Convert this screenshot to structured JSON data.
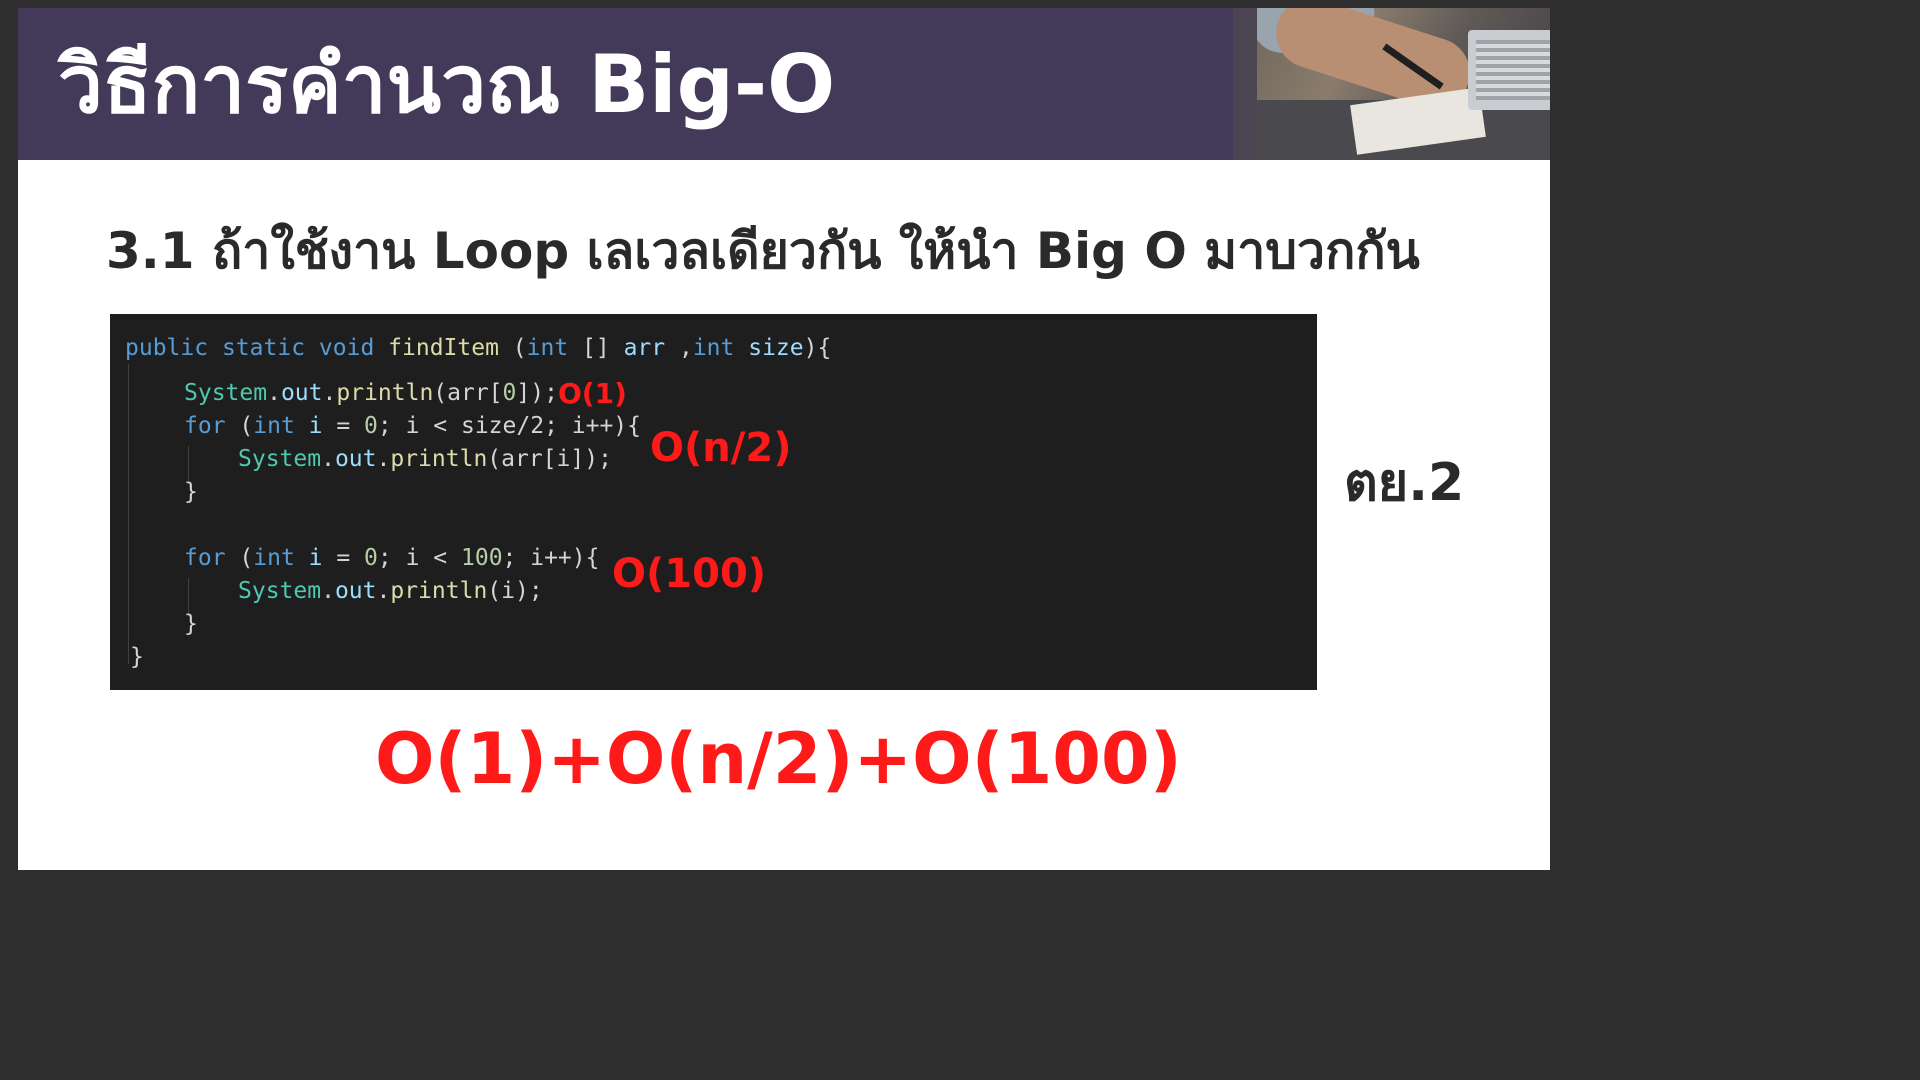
{
  "title": "วิธีการคำนวณ Big-O",
  "subtitle": "3.1 ถ้าใช้งาน Loop เลเวลเดียวกัน ให้นำ Big O มาบวกกัน",
  "code": {
    "line1": {
      "kw1": "public",
      "kw2": "static",
      "kw3": "void",
      "fn": "findItem",
      "open": " (",
      "t1": "int",
      "br": " [] ",
      "v1": "arr",
      "comma": " ,",
      "t2": "int",
      "v2": "size",
      "close": "){"
    },
    "line2": {
      "cls": "System",
      "dot1": ".",
      "f1": "out",
      "dot2": ".",
      "m": "println",
      "args": "(arr[",
      "n": "0",
      "end": "]);"
    },
    "line3": {
      "kw": "for",
      "p1": " (",
      "t": "int",
      "v": " i",
      "eq": " = ",
      "n0": "0",
      "mid": "; i < size/2; i++){"
    },
    "line4": {
      "cls": "System",
      "dot1": ".",
      "f1": "out",
      "dot2": ".",
      "m": "println",
      "args": "(arr[i]);"
    },
    "line5": "}",
    "line6": {
      "kw": "for",
      "p1": " (",
      "t": "int",
      "v": " i",
      "eq": " = ",
      "n0": "0",
      "mid": "; i < ",
      "n100": "100",
      "end": "; i++){"
    },
    "line7": {
      "cls": "System",
      "dot1": ".",
      "f1": "out",
      "dot2": ".",
      "m": "println",
      "args": "(i);"
    },
    "line8": "}",
    "line9": "}"
  },
  "annotations": {
    "o1": "O(1)",
    "on2": "O(n/2)",
    "o100": "O(100)"
  },
  "example_label": "ตย.2",
  "formula": "O(1)+O(n/2)+O(100)"
}
